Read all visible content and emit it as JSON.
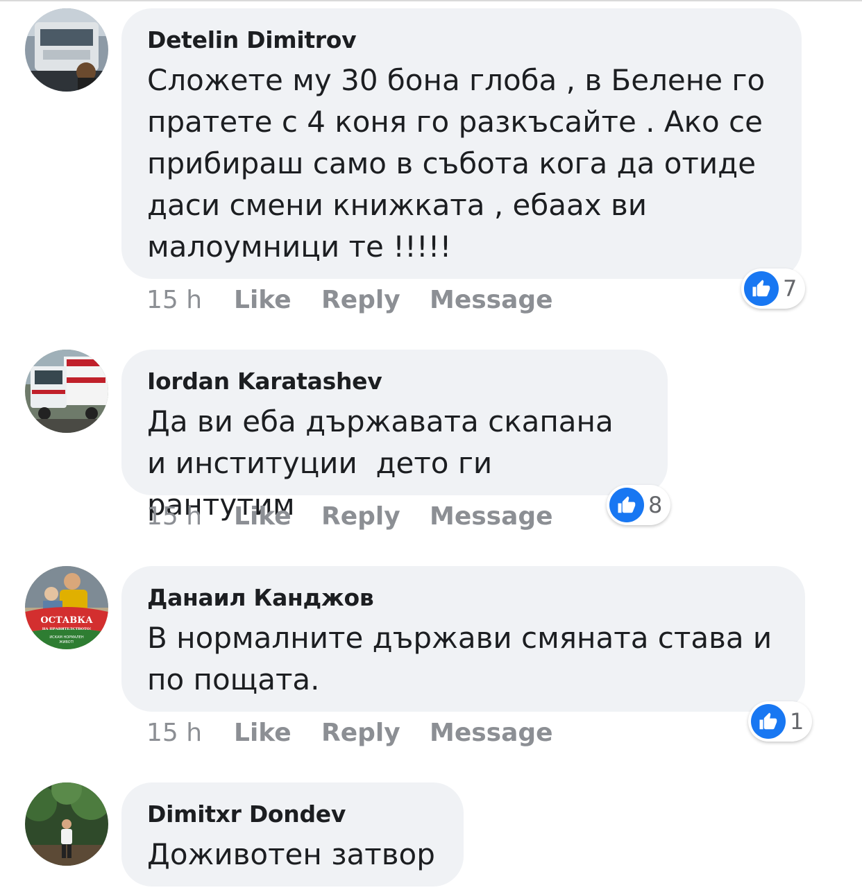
{
  "comments": [
    {
      "author": "Detelin Dimitrov",
      "text": "Сложете му 30 бона глоба , в Белене го пратете с 4 коня го разкъсайте . Ако се прибираш само в събота кога да отиде даси смени книжката , ебаах ви малоумници те !!!!!",
      "time": "15 h",
      "like": "Like",
      "reply": "Reply",
      "message": "Message",
      "reactions": "7",
      "avatar_icon": "avatar-truck-photo"
    },
    {
      "author": "Iordan Karatashev",
      "text": "Да ви еба държавата скапана и институции  дето ги рантутим",
      "time": "15 h",
      "like": "Like",
      "reply": "Reply",
      "message": "Message",
      "reactions": "8",
      "avatar_icon": "avatar-truck-photo"
    },
    {
      "author": "Данаил Канджов",
      "text": "В нормалните държави смяната става и по пощата.",
      "time": "15 h",
      "like": "Like",
      "reply": "Reply",
      "message": "Message",
      "reactions": "1",
      "avatar_icon": "avatar-protest-frame"
    },
    {
      "author": "Dimitxr Dondev",
      "text": "Доживотен затвор",
      "avatar_icon": "avatar-person-photo"
    }
  ],
  "avatar_badge": {
    "line1": "ОСТАВКА",
    "line2": "НА ПРАВИТЕЛСТВОТО!",
    "line3": "ИСКАМ НОРМАЛЕН",
    "line4": "ЖИВОТ!"
  },
  "colors": {
    "bubble": "#f0f2f5",
    "text": "#1c1e21",
    "meta": "#8c8f94",
    "like_blue": "#1877f2"
  }
}
